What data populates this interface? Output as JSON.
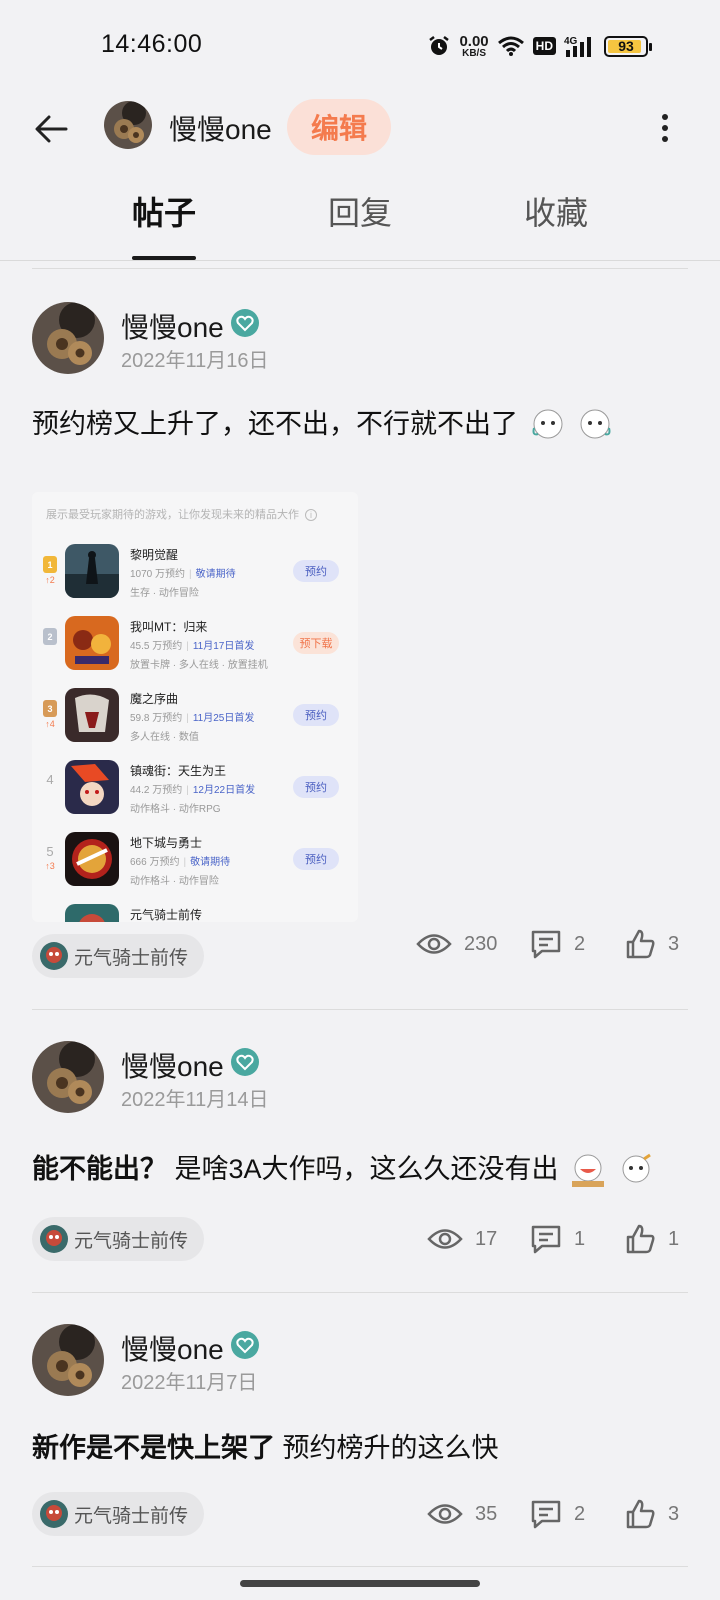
{
  "status_bar": {
    "time": "14:46:00",
    "net_speed_value": "0.00",
    "net_speed_unit": "KB/S",
    "hd": "HD",
    "network": "4G",
    "battery": "93",
    "battery_level": 0.93
  },
  "header": {
    "back_icon": "arrow-left-icon",
    "username": "慢慢one",
    "edit_label": "编辑",
    "more_icon": "more-vertical-icon"
  },
  "tabs": [
    {
      "label": "帖子",
      "active": true
    },
    {
      "label": "回复",
      "active": false
    },
    {
      "label": "收藏",
      "active": false
    }
  ],
  "posts": [
    {
      "author": "慢慢one",
      "date": "2022年11月16日",
      "text": "预约榜又上升了，还不出，不行就不出了",
      "game_tag": "元气骑士前传",
      "views": "230",
      "comments": "2",
      "likes": "3",
      "embed": {
        "caption": "展示最受玩家期待的游戏，让你发现未来的精品大作",
        "info_icon": "info-icon",
        "games": [
          {
            "rank": "1",
            "trend": "↑2",
            "name": "黎明觉醒",
            "reservations": "1070 万预约",
            "release": "敬请期待",
            "tags": "生存 · 动作冒险",
            "button": "预约"
          },
          {
            "rank": "2",
            "trend": "",
            "name": "我叫MT：归来",
            "reservations": "45.5 万预约",
            "release": "11月17日首发",
            "tags": "放置卡牌 · 多人在线 · 放置挂机",
            "button": "预下载"
          },
          {
            "rank": "3",
            "trend": "↑4",
            "name": "魔之序曲",
            "reservations": "59.8 万预约",
            "release": "11月25日首发",
            "tags": "多人在线 · 数值",
            "button": "预约"
          },
          {
            "rank": "4",
            "trend": "",
            "name": "镇魂街：天生为王",
            "reservations": "44.2 万预约",
            "release": "12月22日首发",
            "tags": "动作格斗 · 动作RPG",
            "button": "预约"
          },
          {
            "rank": "5",
            "trend": "↑3",
            "name": "地下城与勇士",
            "reservations": "666 万预约",
            "release": "敬请期待",
            "tags": "动作格斗 · 动作冒险",
            "button": "预约"
          },
          {
            "rank": "",
            "trend": "",
            "name": "元气骑士前传",
            "reservations": "",
            "release": "",
            "tags": "",
            "button": ""
          }
        ]
      }
    },
    {
      "author": "慢慢one",
      "date": "2022年11月14日",
      "text_bold": "能不能出？",
      "text_rest": "是啥3A大作吗，这么久还没有出",
      "game_tag": "元气骑士前传",
      "views": "17",
      "comments": "1",
      "likes": "1"
    },
    {
      "author": "慢慢one",
      "date": "2022年11月7日",
      "text_bold": "新作是不是快上架了",
      "text_rest": "预约榜升的这么快",
      "game_tag": "元气骑士前传",
      "views": "35",
      "comments": "2",
      "likes": "3"
    }
  ],
  "icons": {
    "verified": "verified-heart-badge-icon",
    "views": "eye-icon",
    "comments": "comment-icon",
    "likes": "thumbs-up-icon",
    "sticker": "sticker-icon"
  },
  "colors": {
    "accent": "#f47b4e",
    "edit_bg": "#fbe0d7",
    "verified": "#4aa8a0",
    "background": "#f2f2f4"
  }
}
